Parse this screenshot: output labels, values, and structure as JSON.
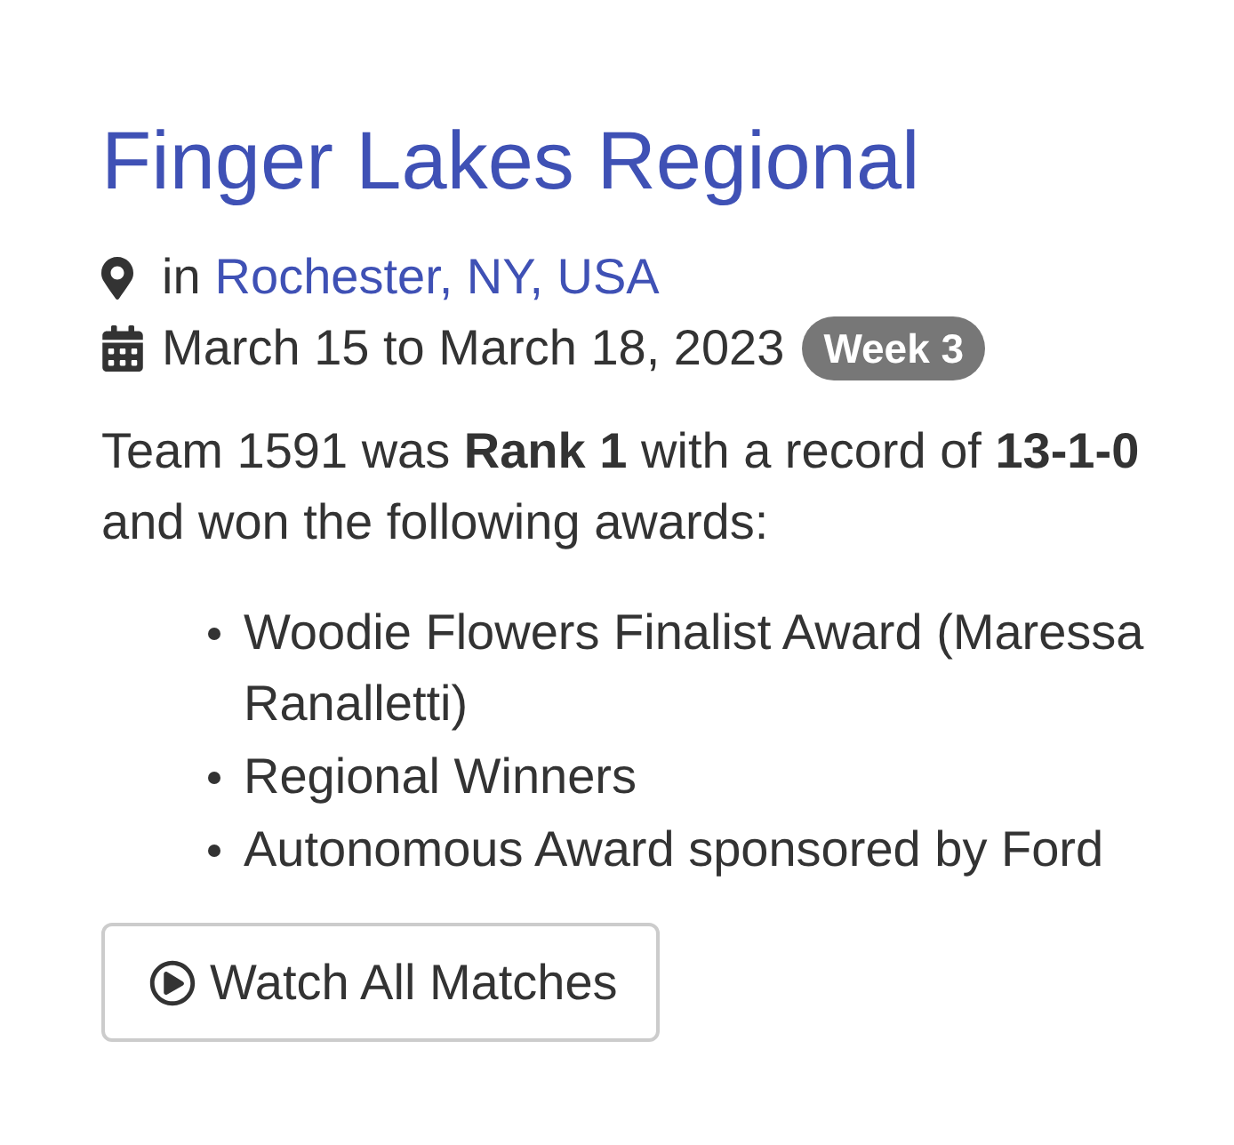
{
  "event": {
    "title": "Finger Lakes Regional",
    "location": {
      "prefix": "in",
      "link": "Rochester, NY, USA"
    },
    "dates": "March 15 to March 18, 2023",
    "week_badge": "Week 3"
  },
  "summary": "Team 1591 was **Rank 1** with a record of **13-1-0** and won the following awards:",
  "awards": [
    "Woodie Flowers Finalist Award (Maressa Ranalletti)",
    "Regional Winners",
    "Autonomous Award sponsored by Ford"
  ],
  "button": {
    "label": "Watch All Matches"
  }
}
